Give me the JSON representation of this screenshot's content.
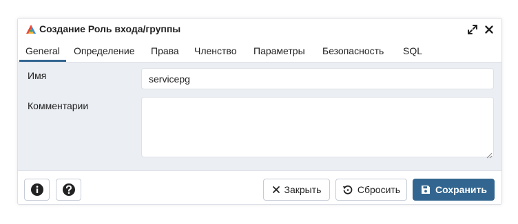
{
  "dialog": {
    "title": "Создание Роль входа/группы",
    "icons": {
      "app": "pgadmin-elephant-icon",
      "maximize": "expand-arrows-icon",
      "close": "close-icon"
    }
  },
  "tabs": [
    {
      "label": "General",
      "active": true
    },
    {
      "label": "Определение",
      "active": false
    },
    {
      "label": "Права",
      "active": false
    },
    {
      "label": "Членство",
      "active": false
    },
    {
      "label": "Параметры",
      "active": false
    },
    {
      "label": "Безопасность",
      "active": false
    },
    {
      "label": "SQL",
      "active": false
    }
  ],
  "form": {
    "name_label": "Имя",
    "name_value": "servicepg",
    "comment_label": "Комментарии",
    "comment_value": ""
  },
  "footer": {
    "info_icon": "info-icon",
    "help_icon": "help-icon",
    "close_label": "Закрыть",
    "reset_label": "Сбросить",
    "save_label": "Сохранить"
  },
  "colors": {
    "accent": "#326690",
    "pane_background": "#ebeef3",
    "border": "#dde0e6"
  }
}
